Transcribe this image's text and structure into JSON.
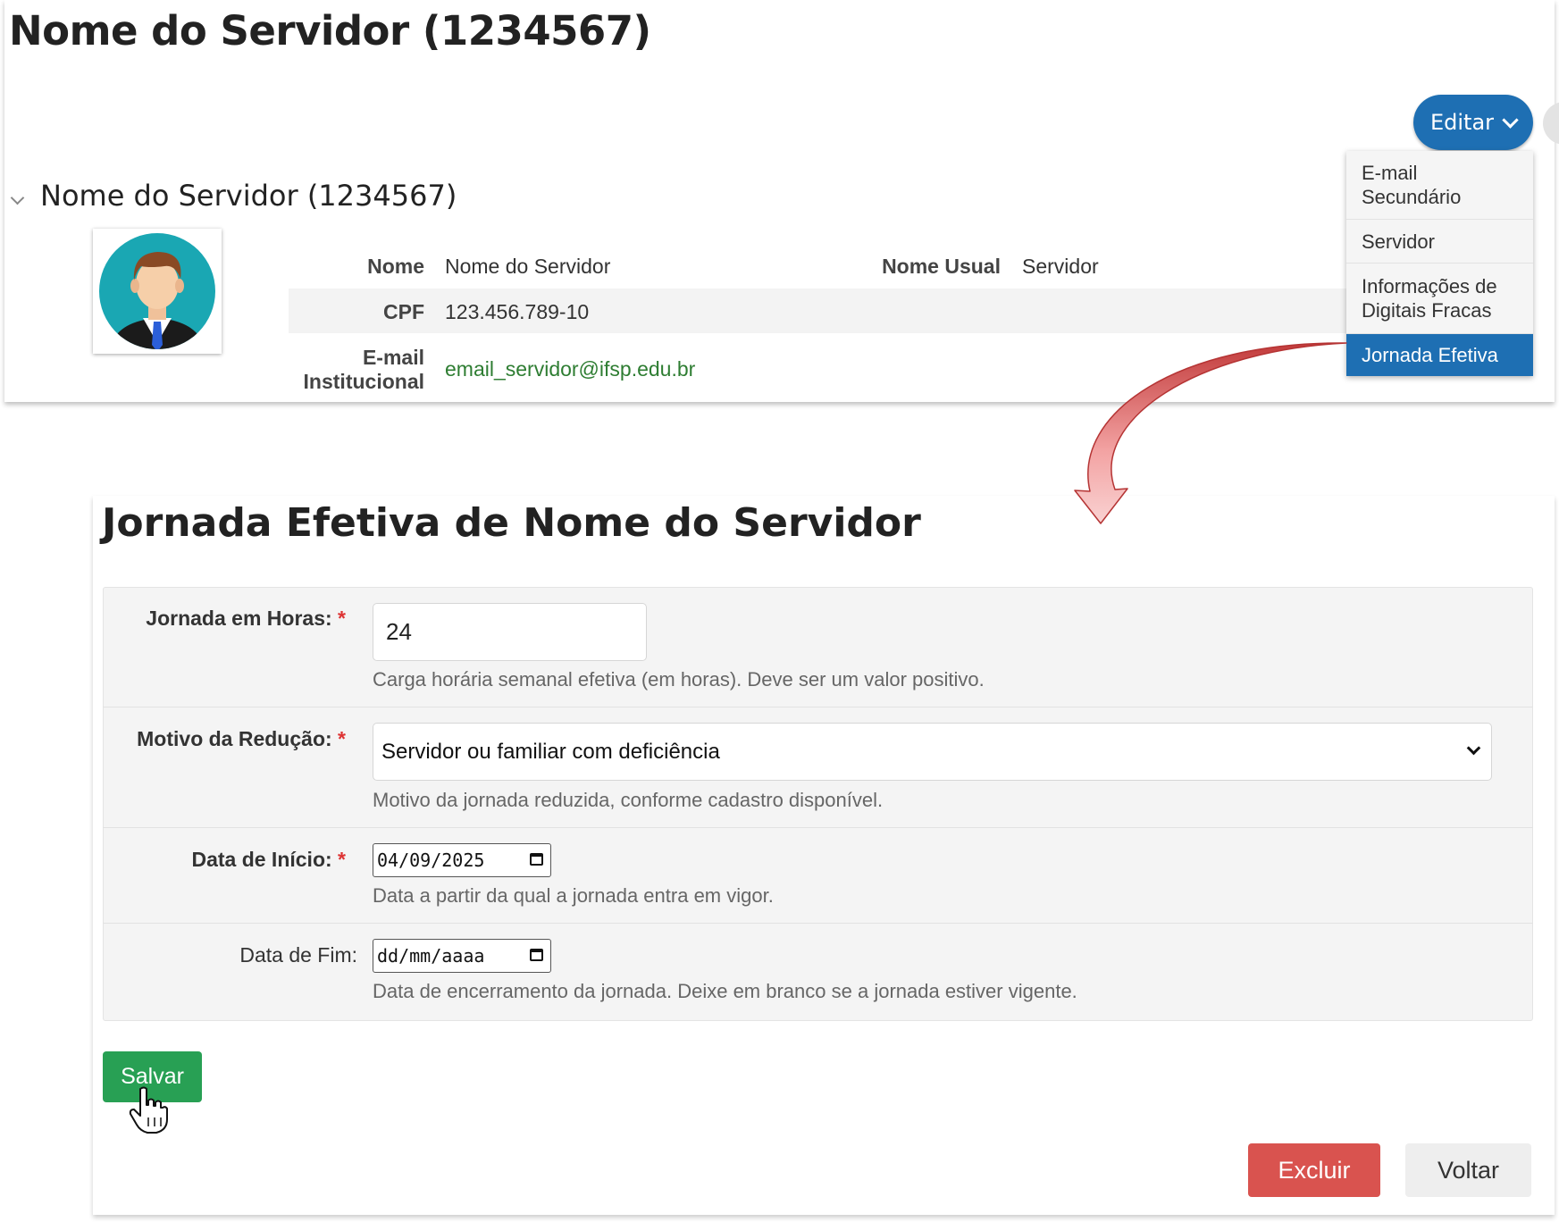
{
  "header": {
    "page_title": "Nome do Servidor (1234567)",
    "edit_label": "Editar"
  },
  "profile": {
    "section_title": "Nome do Servidor (1234567)",
    "fields": {
      "nome_label": "Nome",
      "nome_value": "Nome do Servidor",
      "nome_usual_label": "Nome Usual",
      "nome_usual_value": "Servidor",
      "cpf_label": "CPF",
      "cpf_value": "123.456.789-10",
      "email_label_line1": "E-mail",
      "email_label_line2": "Institucional",
      "email_value": "email_servidor@ifsp.edu.br"
    }
  },
  "dropdown": {
    "items": [
      {
        "line1": "E-mail",
        "line2": "Secundário",
        "active": false
      },
      {
        "line1": "Servidor",
        "line2": "",
        "active": false
      },
      {
        "line1": "Informações de",
        "line2": "Digitais Fracas",
        "active": false
      },
      {
        "line1": "Jornada Efetiva",
        "line2": "",
        "active": true
      }
    ]
  },
  "form": {
    "title": "Jornada Efetiva de Nome do Servidor",
    "jornada": {
      "label": "Jornada em Horas:",
      "value": "24",
      "help": "Carga horária semanal efetiva (em horas). Deve ser um valor positivo."
    },
    "motivo": {
      "label": "Motivo da Redução:",
      "value": "Servidor ou familiar com deficiência",
      "help": "Motivo da jornada reduzida, conforme cadastro disponível."
    },
    "inicio": {
      "label": "Data de Início:",
      "value": "04/09/2025",
      "help": "Data a partir da qual a jornada entra em vigor."
    },
    "fim": {
      "label": "Data de Fim:",
      "value": "dd/mm/aaaa",
      "help": "Data de encerramento da jornada. Deixe em branco se a jornada estiver vigente."
    },
    "required_mark": "*",
    "save_label": "Salvar",
    "delete_label": "Excluir",
    "back_label": "Voltar"
  },
  "colors": {
    "primary": "#1e6fb3",
    "success": "#28a054",
    "danger": "#d9534f",
    "link": "#2e7d32"
  },
  "icons": [
    "chevron-down-icon",
    "calendar-icon",
    "hand-pointer-icon",
    "user-avatar",
    "curved-arrow"
  ]
}
